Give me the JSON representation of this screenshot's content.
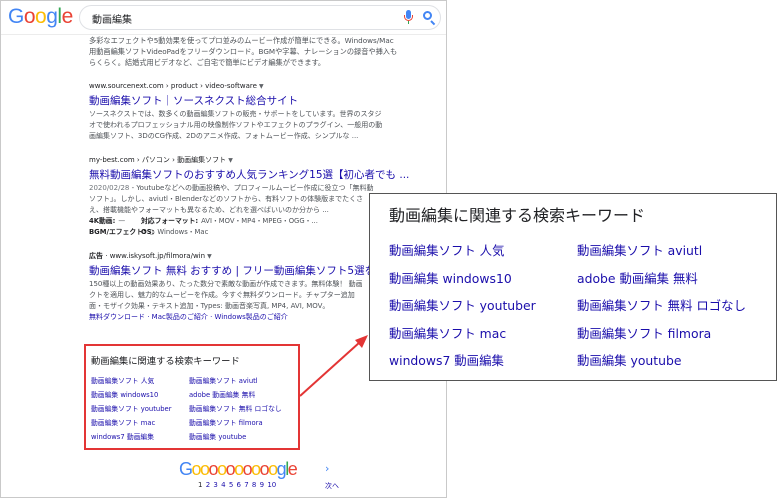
{
  "logo": {
    "text": "Google",
    "colors": [
      "#4285F4",
      "#EA4335",
      "#FBBC05",
      "#4285F4",
      "#34A853",
      "#EA4335"
    ]
  },
  "search": {
    "query": "動画編集"
  },
  "top_snippet": [
    "多彩なエフェクトや5動効果を使ってプロ並みのムービー作成が簡単にできる。Windows/Mac",
    "用動画編集ソフトVideoPadをフリーダウンロード。BGMや字幕、ナレーションの録音や挿入も",
    "らくらく。結婚式用ビデオなど、ご自宅で簡単にビデオ編集ができます。"
  ],
  "results": [
    {
      "cite": "www.sourcenext.com › product › video-software",
      "title": "動画編集ソフト｜ソースネクスト総合サイト",
      "snippet": [
        "ソースネクストでは、数多くの動画編集ソフトの販売・サポートをしています。世界のスタジ",
        "オで使われるプロフェッショナル用の映像制作ソフトやエフェクトのプラグイン、一般用の動",
        "画編集ソフト、3DのCG作成、2Dのアニメ作成、フォトムービー作成、シンプルな ..."
      ]
    },
    {
      "cite": "my-best.com › パソコン › 動画編集ソフト",
      "title": "無料動画編集ソフトのおすすめ人気ランキング15選【初心者でも ...",
      "snippet_date": "2020/02/28",
      "snippet": [
        " - Youtubeなどへの動画投稿や、プロフィールムービー作成に役立つ「無料動",
        "ソフト」。しかし、aviutl・Blenderなどのソフトから、有料ソフトの体験版までたくさ",
        "え、搭載機能やフォーマットも異なるため、どれを選べばいいのか分から ..."
      ],
      "specs": [
        {
          "k": "4K動画:",
          "v": "—"
        },
        {
          "k": "対応フォーマット:",
          "v": "AVI・MOV・MP4・MPEG・OGG・..."
        },
        {
          "k": "BGM/エフェクト:",
          "v": "○"
        },
        {
          "k": "OS:",
          "v": "Windows・Mac"
        }
      ]
    },
    {
      "ad_label": "広告",
      "cite": "www.iskysoft.jp/filmora/win",
      "title": "動画編集ソフト 無料 おすすめ | フリー動画編集ソフト5選を",
      "snippet": [
        "150種以上の動画効果あり、たった数分で素敵な動画が作成できます。無料体験！ 動画",
        "クトを適用し、魅力的なムービーを作成。今すぐ無料ダウンロード。チャプター追加",
        "面・モザイク効果・テキスト追加・Types: 動画音楽写真, MP4, AVI, MOV。"
      ],
      "sitelinks": "無料ダウンロード · Mac製品のご紹介 · Windows製品のご紹介"
    }
  ],
  "related": {
    "title": "動画編集に関連する検索キーワード",
    "items": [
      "動画編集ソフト 人気",
      "動画編集ソフト aviutl",
      "動画編集 windows10",
      "adobe 動画編集 無料",
      "動画編集ソフト youtuber",
      "動画編集ソフト 無料 ロゴなし",
      "動画編集ソフト mac",
      "動画編集ソフト filmora",
      "windows7 動画編集",
      "動画編集 youtube"
    ]
  },
  "pagination": {
    "wordmark": "Goooooooooogle",
    "pages": [
      "1",
      "2",
      "3",
      "4",
      "5",
      "6",
      "7",
      "8",
      "9",
      "10"
    ],
    "next_label": "次へ"
  },
  "colors": {
    "link": "#1a0dab",
    "highlight": "#e33535"
  }
}
